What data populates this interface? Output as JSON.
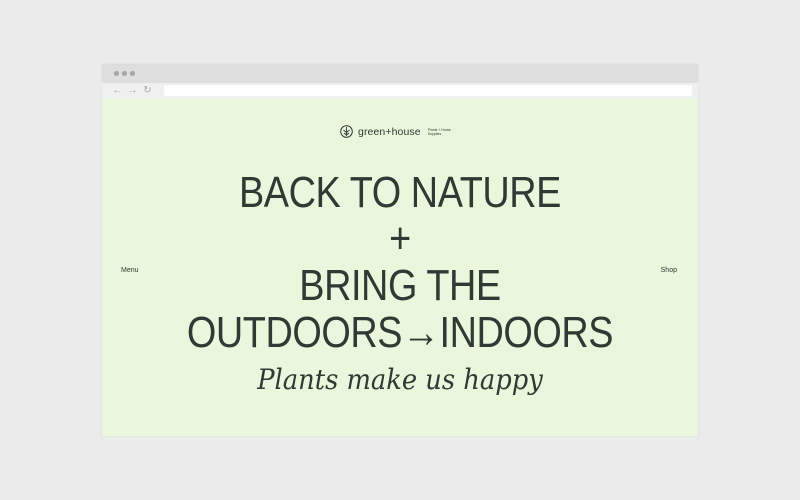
{
  "brand": {
    "name": "green+house",
    "tagline_small": "Plants + Home Supplies"
  },
  "nav": {
    "menu_label": "Menu",
    "shop_label": "Shop"
  },
  "hero": {
    "line1": "BACK TO NATURE",
    "plus": "+",
    "line2": "BRING THE",
    "line3": "OUTDOORS→INDOORS",
    "tagline": "Plants make us happy"
  },
  "colors": {
    "background": "#e9f8dc",
    "text": "#2e3a33"
  }
}
